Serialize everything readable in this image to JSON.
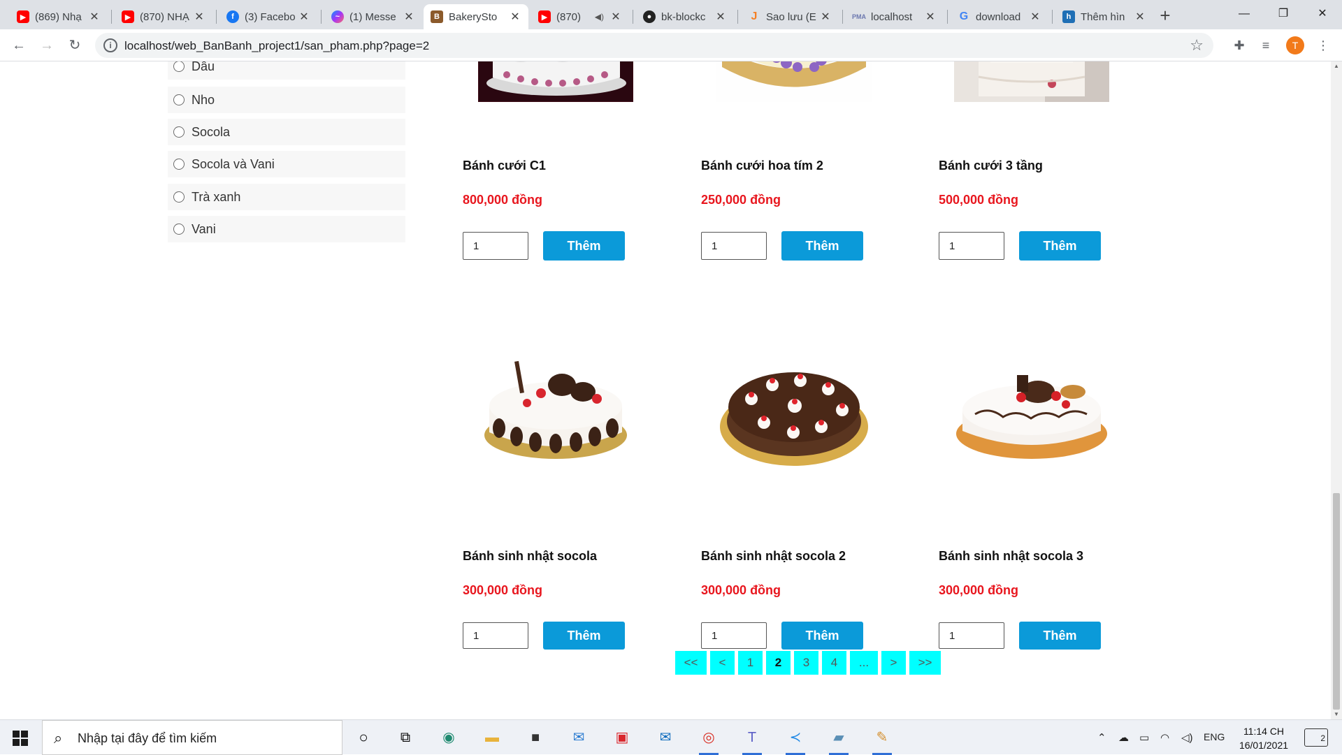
{
  "browser": {
    "tabs": [
      {
        "title": "(869) Nhạ",
        "icon": "youtube-icon"
      },
      {
        "title": "(870) NHẠ",
        "icon": "youtube-icon"
      },
      {
        "title": "(3) Facebo",
        "icon": "facebook-icon"
      },
      {
        "title": "(1) Messe",
        "icon": "messenger-icon"
      },
      {
        "title": "BakerySto",
        "icon": "bakery-icon",
        "active": true
      },
      {
        "title": "(870)",
        "icon": "youtube-icon"
      },
      {
        "title": "bk-blockc",
        "icon": "github-icon"
      },
      {
        "title": "Sao lưu (E",
        "icon": "j-icon"
      },
      {
        "title": "localhost",
        "icon": "phpmyadmin-icon"
      },
      {
        "title": "download",
        "icon": "google-icon"
      },
      {
        "title": "Thêm hìn",
        "icon": "h-icon"
      }
    ],
    "url": "localhost/web_BanBanh_project1/san_pham.php?page=2",
    "profile_initial": "T"
  },
  "filters": {
    "options": [
      "Dâu",
      "Nho",
      "Socola",
      "Socola và Vani",
      "Trà xanh",
      "Vani"
    ]
  },
  "products": [
    {
      "name": "Bánh cưới C1",
      "price": "800,000 đồng",
      "qty": "1",
      "button": "Thêm"
    },
    {
      "name": "Bánh cưới hoa tím 2",
      "price": "250,000 đồng",
      "qty": "1",
      "button": "Thêm"
    },
    {
      "name": "Bánh cưới 3 tầng",
      "price": "500,000 đồng",
      "qty": "1",
      "button": "Thêm"
    },
    {
      "name": "Bánh sinh nhật socola",
      "price": "300,000 đồng",
      "qty": "1",
      "button": "Thêm"
    },
    {
      "name": "Bánh sinh nhật socola 2",
      "price": "300,000 đồng",
      "qty": "1",
      "button": "Thêm"
    },
    {
      "name": "Bánh sinh nhật socola 3",
      "price": "300,000 đồng",
      "qty": "1",
      "button": "Thêm"
    }
  ],
  "pagination": {
    "items": [
      "<<",
      "<",
      "1",
      "2",
      "3",
      "4",
      "...",
      ">",
      ">>"
    ],
    "current": "2"
  },
  "taskbar": {
    "search_placeholder": "Nhập tại đây để tìm kiếm",
    "language": "ENG",
    "time": "11:14 CH",
    "date": "16/01/2021",
    "notifications": "2"
  },
  "colors": {
    "accent_button": "#0b9ad9",
    "price": "#e8161e",
    "pager": "#00ffff"
  }
}
